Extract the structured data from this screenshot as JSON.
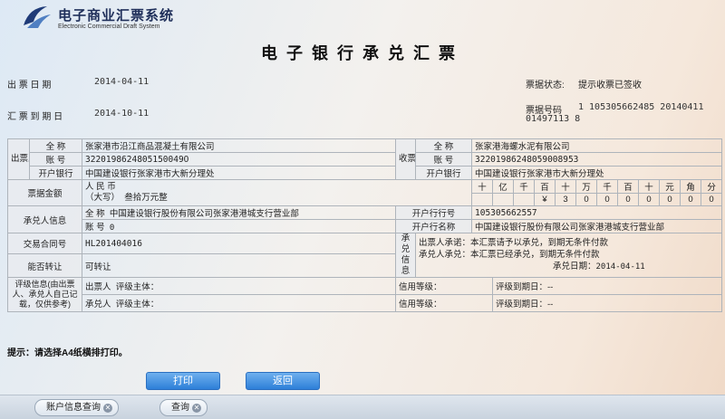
{
  "brand": {
    "title_cn": "电子商业汇票系统",
    "title_en": "Electronic Commercial Draft System"
  },
  "page_title": "电子银行承兑汇票",
  "issue_date_label": "出 票 日 期",
  "issue_date": "2014-04-11",
  "due_date_label": "汇 票 到 期 日",
  "due_date": "2014-10-11",
  "status_label": "票据状态:",
  "status": "提示收票已签收",
  "bill_no_label": "票据号码",
  "bill_no_line1": "1 105305662485 20140411",
  "bill_no_line2": "01497113 8",
  "drawer": {
    "section": "出票人",
    "name_label": "全 称",
    "name": "张家港市沿江商品混凝土有限公司",
    "account_label": "账 号",
    "account": "3220198624805150049O",
    "bank_label": "开户银行",
    "bank": "中国建设银行张家港市大新分理处"
  },
  "payee": {
    "section": "收票人",
    "name_label": "全 称",
    "name": "张家港海螺水泥有限公司",
    "account_label": "账 号",
    "account": "32201986248059008953",
    "bank_label": "开户银行",
    "bank": "中国建设银行张家港市大新分理处"
  },
  "amount": {
    "label": "票据金额",
    "currency": "人 民 币",
    "daxie": "（大写）",
    "words": "叁拾万元整",
    "units": [
      "十",
      "亿",
      "千",
      "百",
      "十",
      "万",
      "千",
      "百",
      "十",
      "元",
      "角",
      "分"
    ],
    "digits": [
      "",
      "",
      "",
      "¥",
      "3",
      "0",
      "0",
      "0",
      "0",
      "0",
      "0",
      "0"
    ]
  },
  "acceptor": {
    "label": "承兑人信息",
    "name_label": "全 称",
    "name": "中国建设银行股份有限公司张家港港城支行营业部",
    "account_label": "账 号",
    "account": "0",
    "bank_no_label": "开户行行号",
    "bank_no": "105305662557",
    "bank_name_label": "开户行名称",
    "bank_name": "中国建设银行股份有限公司张家港港城支行营业部"
  },
  "contract": {
    "label": "交易合同号",
    "value": "HL201404016"
  },
  "transfer": {
    "label": "能否转让",
    "value": "可转让"
  },
  "acceptance": {
    "label": "承兑信息",
    "line1": "出票人承诺：本汇票请予以承兑，到期无条件付款",
    "line2": "承兑人承兑：本汇票已经承兑，到期无条件付款",
    "date_label": "承兑日期：",
    "date": "2014-04-11"
  },
  "rating": {
    "label": "评级信息(由出票人、承兑人自己记载，仅供参考)",
    "rows": [
      {
        "who": "出票人",
        "subject": "评级主体：",
        "grade": "信用等级：",
        "expiry": "评级到期日：--"
      },
      {
        "who": "承兑人",
        "subject": "评级主体：",
        "grade": "信用等级：",
        "expiry": "评级到期日：--"
      }
    ]
  },
  "tip": "提示：请选择A4纸横排打印。",
  "buttons": {
    "print": "打印",
    "back": "返回"
  },
  "tabs": [
    {
      "label": "账户信息查询"
    },
    {
      "label": "查询"
    }
  ],
  "colors": {
    "button": "#2d7fd8",
    "border": "#aeb4bb"
  }
}
